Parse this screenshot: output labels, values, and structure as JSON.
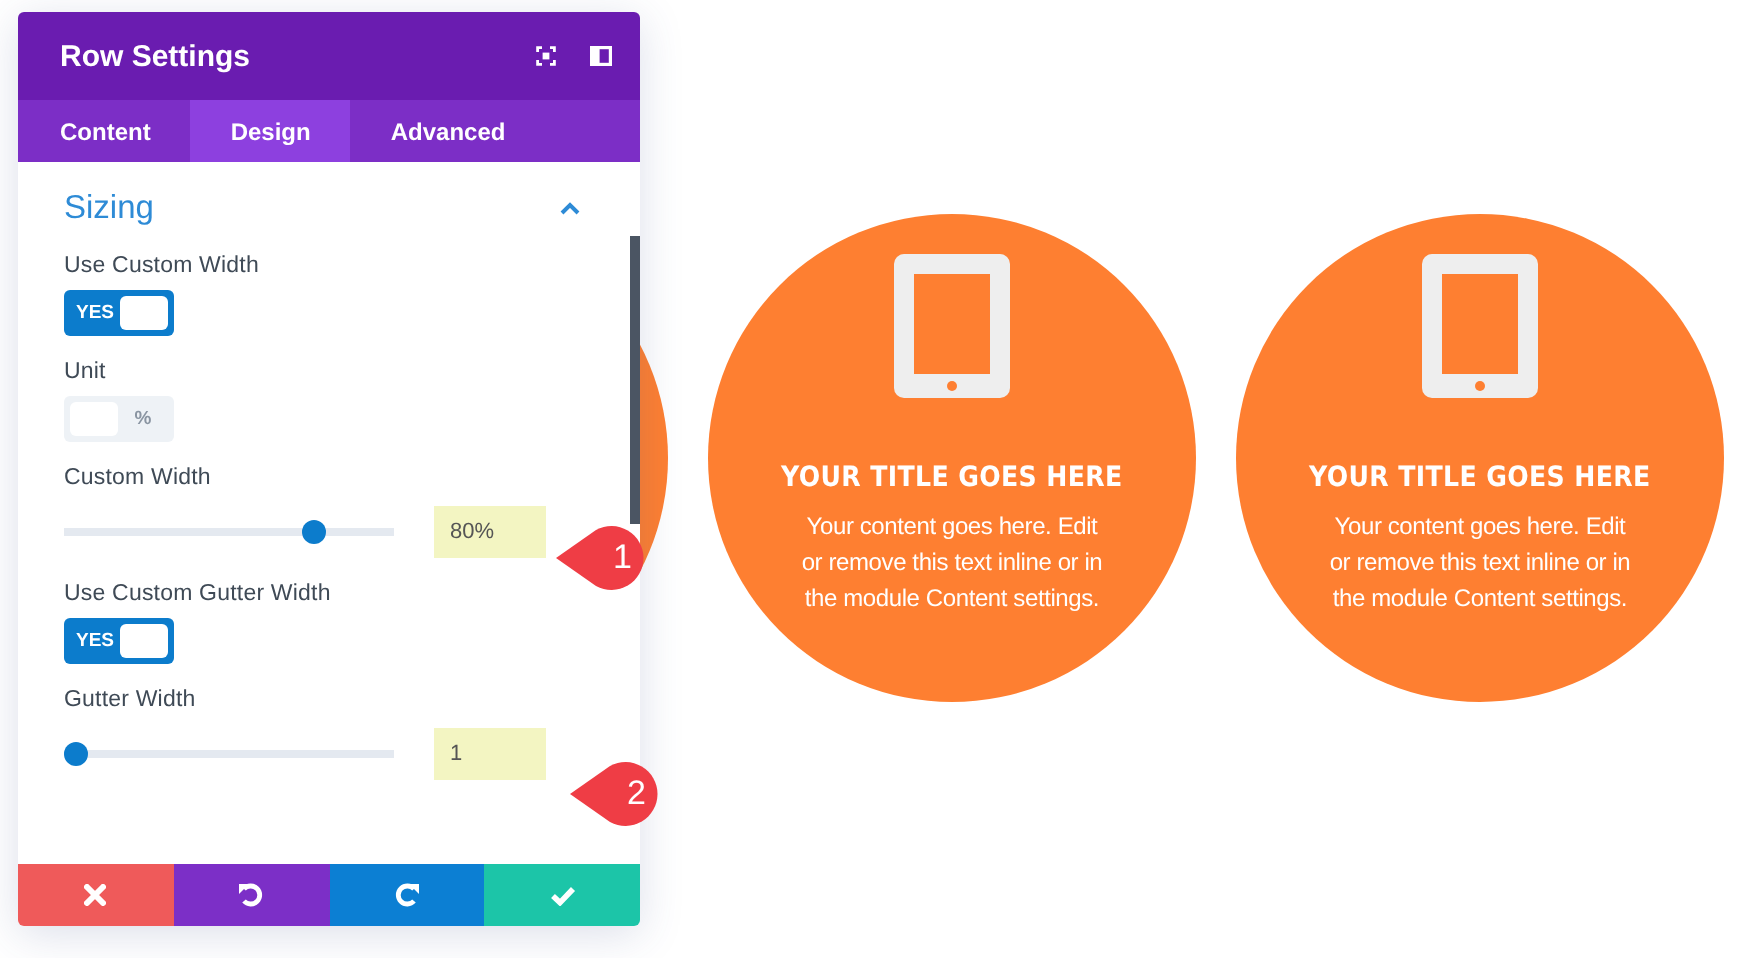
{
  "panel": {
    "title": "Row Settings",
    "tabs": [
      {
        "label": "Content",
        "selected": false
      },
      {
        "label": "Design",
        "selected": true
      },
      {
        "label": "Advanced",
        "selected": false
      }
    ],
    "section": {
      "title": "Sizing",
      "expanded": true
    },
    "fields": [
      {
        "kind": "toggle",
        "label": "Use Custom Width",
        "on": true,
        "text": "YES"
      },
      {
        "kind": "toggle",
        "label": "Unit",
        "on": false,
        "text": "%"
      },
      {
        "kind": "slider",
        "label": "Custom Width",
        "level": 0.78,
        "value": "80%"
      },
      {
        "kind": "toggle",
        "label": "Use Custom Gutter Width",
        "on": true,
        "text": "YES"
      },
      {
        "kind": "slider",
        "label": "Gutter Width",
        "level": 0,
        "value": "1"
      }
    ],
    "footer_buttons": [
      {
        "kind": "cancel"
      },
      {
        "kind": "undo"
      },
      {
        "kind": "redo"
      },
      {
        "kind": "save"
      }
    ]
  },
  "callouts": [
    {
      "number": "1"
    },
    {
      "number": "2"
    }
  ],
  "modules": [
    {
      "kind": "circle"
    },
    {
      "kind": "circle",
      "title": "YOUR TITLE GOES HERE",
      "body": "Your content goes here. Edit or remove this text inline or in the module Content settings."
    },
    {
      "kind": "circle",
      "title": "YOUR TITLE GOES HERE",
      "body": "Your content goes here. Edit or remove this text inline or in the module Content settings."
    }
  ]
}
